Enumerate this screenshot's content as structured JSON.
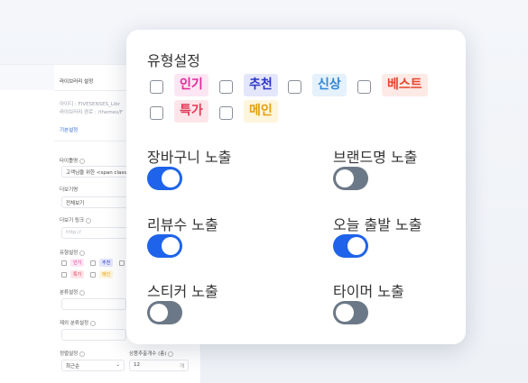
{
  "background_form": {
    "header_title": "라이브러리 설정",
    "id_line": "아이디 : FIVESENSES_Libr",
    "path_line": "라이브러리 경로 : /themes/F",
    "section": "기본설정",
    "title_label": "타이틀명",
    "title_value": "고객님을 위한 <span class",
    "more_label": "더보기명",
    "more_value": "전체보기",
    "more_link_label": "더보기 링크",
    "more_link_placeholder": "http://",
    "type_label": "유형설정",
    "type_tags": [
      "인기",
      "추천",
      "특가",
      "메인"
    ],
    "category_label": "분류설정",
    "exclude_label": "제외 분류설정",
    "sort_label": "정렬설정",
    "sort_value": "최근순",
    "count_label": "상품추출개수 (총)",
    "count_value": "12",
    "count_unit": "개"
  },
  "popup": {
    "title": "유형설정",
    "type_options": [
      {
        "label": "인기",
        "color": "#e0299a",
        "bg": "#fde6f3",
        "checked": false
      },
      {
        "label": "추천",
        "color": "#2b36c6",
        "bg": "#e4e6fb",
        "checked": false
      },
      {
        "label": "신상",
        "color": "#2f86d6",
        "bg": "#e5f1fb",
        "checked": false
      },
      {
        "label": "베스트",
        "color": "#e8452d",
        "bg": "#fdeae6",
        "checked": false
      },
      {
        "label": "특가",
        "color": "#e23b56",
        "bg": "#fde5ea",
        "checked": false
      },
      {
        "label": "메인",
        "color": "#e2a00f",
        "bg": "#fdf5dc",
        "checked": false
      }
    ],
    "toggles": [
      {
        "label": "장바구니 노출",
        "on": true
      },
      {
        "label": "브랜드명 노출",
        "on": false
      },
      {
        "label": "리뷰수 노출",
        "on": true
      },
      {
        "label": "오늘 출발 노출",
        "on": true
      },
      {
        "label": "스티커 노출",
        "on": false
      },
      {
        "label": "타이머 노출",
        "on": false
      }
    ]
  }
}
